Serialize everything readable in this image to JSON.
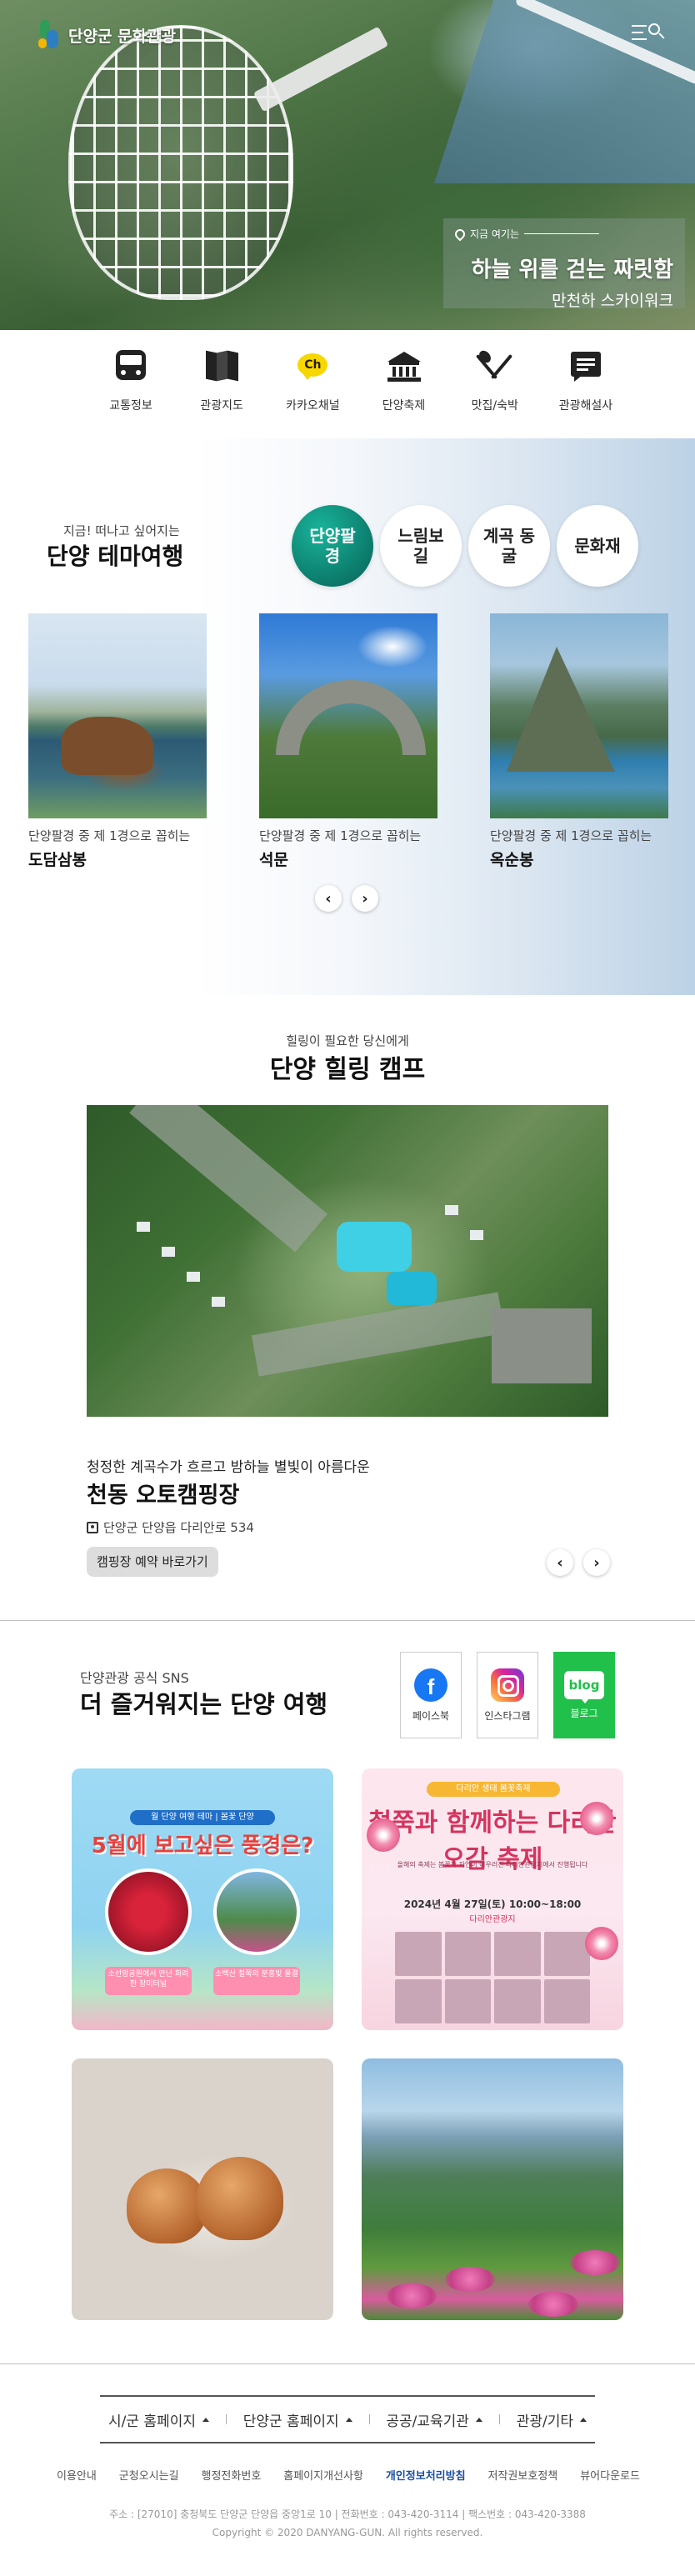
{
  "header": {
    "logo_text": "단양군 문화관광",
    "menu_icon": "menu-search-icon"
  },
  "hero": {
    "now_label": "지금 여기는",
    "title": "하늘 위를 걷는 짜릿함",
    "subtitle": "만천하 스카이워크"
  },
  "quick_menu": [
    {
      "label": "교통정보",
      "icon": "bus-icon"
    },
    {
      "label": "관광지도",
      "icon": "map-icon"
    },
    {
      "label": "카카오채널",
      "icon": "kakao-channel-icon",
      "glyph": "Ch"
    },
    {
      "label": "단양축제",
      "icon": "temple-icon"
    },
    {
      "label": "맛집/숙박",
      "icon": "utensils-icon"
    },
    {
      "label": "관광해설사",
      "icon": "chat-icon"
    }
  ],
  "theme": {
    "subtitle": "지금! 떠나고 싶어지는",
    "title": "단양 테마여행",
    "tabs": [
      "단양팔경",
      "느림보길",
      "계곡 동굴",
      "문화재"
    ],
    "active_tab": "단양팔경",
    "cards": [
      {
        "desc": "단양팔경 중 제 1경으로 꼽히는",
        "name": "도담삼봉"
      },
      {
        "desc": "단양팔경 중 제 1경으로 꼽히는",
        "name": "석문"
      },
      {
        "desc": "단양팔경 중 제 1경으로 꼽히는",
        "name": "옥순봉"
      }
    ],
    "prev": "‹",
    "next": "›"
  },
  "camp": {
    "subtitle": "힐링이 필요한 당신에게",
    "title": "단양 힐링 캠프",
    "desc": "청정한 계곡수가 흐르고 밤하늘 별빛이 아름다운",
    "name": "천동 오토캠핑장",
    "address": "단양군 단양읍 다리안로 534",
    "button": "캠핑장 예약 바로가기",
    "prev": "‹",
    "next": "›"
  },
  "sns": {
    "subtitle": "단양관광 공식 SNS",
    "title": "더 즐거워지는 단양 여행",
    "links": [
      {
        "label": "페이스북",
        "glyph": "f"
      },
      {
        "label": "인스타그램"
      },
      {
        "label": "블로그",
        "glyph": "blog"
      }
    ],
    "posts": {
      "p1": {
        "badge": "월 단양 여행 테마 | 봄꽃 단양",
        "headline": "5월에 보고싶은 풍경은?",
        "cap1": "소선암공원에서 만난 화려한 장미터널",
        "cap2": "소백산 철쭉의 분홍빛 물결"
      },
      "p2": {
        "tag": "다리안 생태 봄꽃축제",
        "headline": "철쭉과 함께하는 다리안 오감 축제",
        "small": "올해의 축제는 봄꽃과 자연이 어우러진 다리안관광지에서 진행됩니다",
        "date": "2024년 4월 27일(토) 10:00~18:00",
        "place": "다리안관광지"
      }
    }
  },
  "footer": {
    "dropdowns": [
      "시/군 홈페이지",
      "단양군 홈페이지",
      "공공/교육기관",
      "관광/기타"
    ],
    "links": [
      "이용안내",
      "군청오시는길",
      "행정전화번호",
      "홈페이지개선사항",
      "개인정보처리방침",
      "저작권보호정책",
      "뷰어다운로드"
    ],
    "address": "주소 : [27010] 충청북도 단양군 단양읍 중앙1로 10 | 전화번호 : 043-420-3114 | 팩스번호 : 043-420-3388",
    "copyright": "Copyright © 2020 DANYANG-GUN. All rights reserved."
  }
}
